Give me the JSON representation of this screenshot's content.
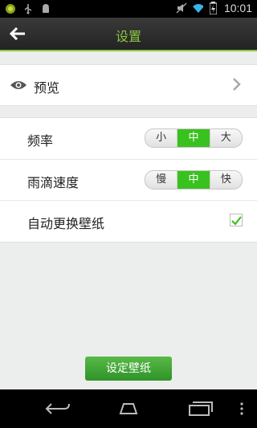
{
  "status_bar": {
    "time": "10:01",
    "icons": [
      "notification-icon",
      "usb-icon",
      "android-debug-icon",
      "mute-icon",
      "wifi-icon",
      "battery-icon"
    ]
  },
  "app_bar": {
    "title": "设置"
  },
  "preview": {
    "label": "预览"
  },
  "settings": {
    "frequency": {
      "label": "频率",
      "options": [
        "小",
        "中",
        "大"
      ],
      "selected": "中"
    },
    "rain_speed": {
      "label": "雨滴速度",
      "options": [
        "慢",
        "中",
        "快"
      ],
      "selected": "中"
    },
    "auto_change": {
      "label": "自动更换壁纸",
      "checked": true
    }
  },
  "action": {
    "button_label": "设定壁纸"
  },
  "colors": {
    "accent": "#8cc63e",
    "active_segment": "#39c21f",
    "button": "#3da332"
  }
}
